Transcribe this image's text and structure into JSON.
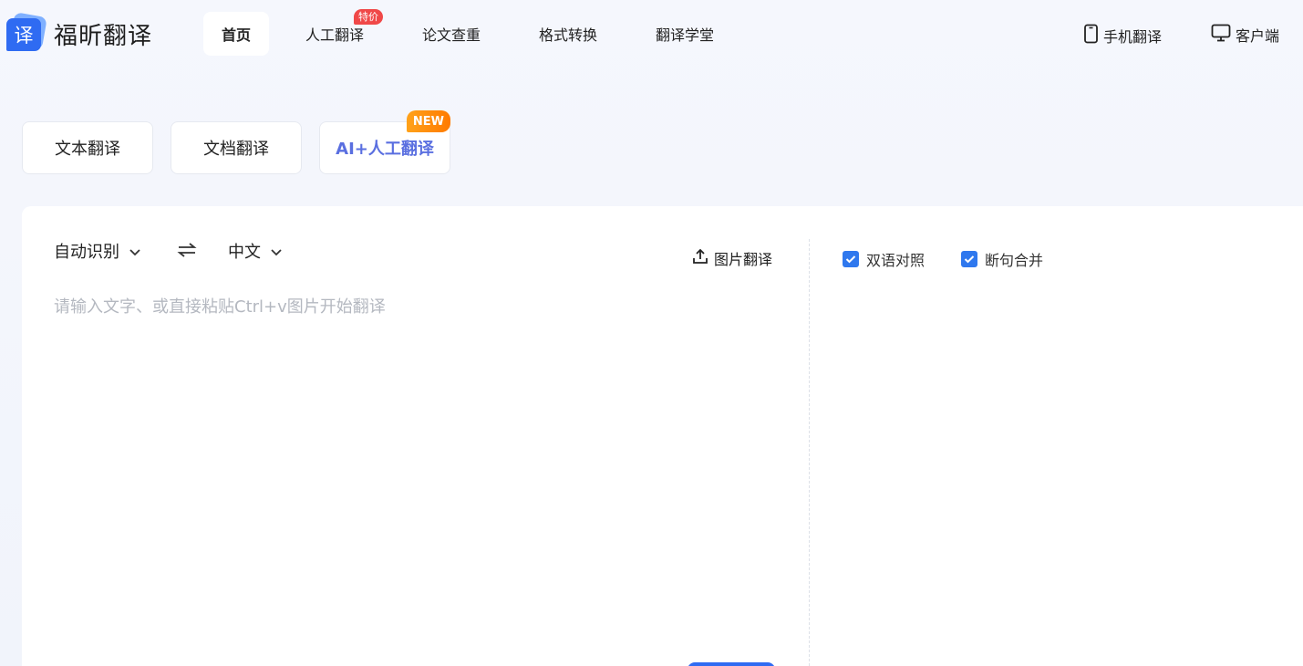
{
  "brand": {
    "name": "福昕翻译",
    "mark": "译",
    "color": "#2f6bf2"
  },
  "nav": [
    {
      "label": "首页",
      "active": true
    },
    {
      "label": "人工翻译",
      "badge": "特价"
    },
    {
      "label": "论文查重"
    },
    {
      "label": "格式转换"
    },
    {
      "label": "翻译学堂"
    }
  ],
  "header_right": {
    "mobile": "手机翻译",
    "client": "客户端"
  },
  "modes": {
    "text": "文本翻译",
    "doc": "文档翻译",
    "ai": "AI+人工翻译",
    "ai_badge": "NEW"
  },
  "translator": {
    "source_lang": "自动识别",
    "target_lang": "中文",
    "image_translate": "图片翻译",
    "placeholder": "请输入文字、或直接粘贴Ctrl+v图片开始翻译",
    "bilingual": {
      "label": "双语对照",
      "checked": true
    },
    "merge": {
      "label": "断句合并",
      "checked": true
    }
  },
  "colors": {
    "accent": "#2f6bf2",
    "checkbox": "#2f78ee",
    "badge_red": "#f04848",
    "badge_orange": "#ff8a00"
  }
}
